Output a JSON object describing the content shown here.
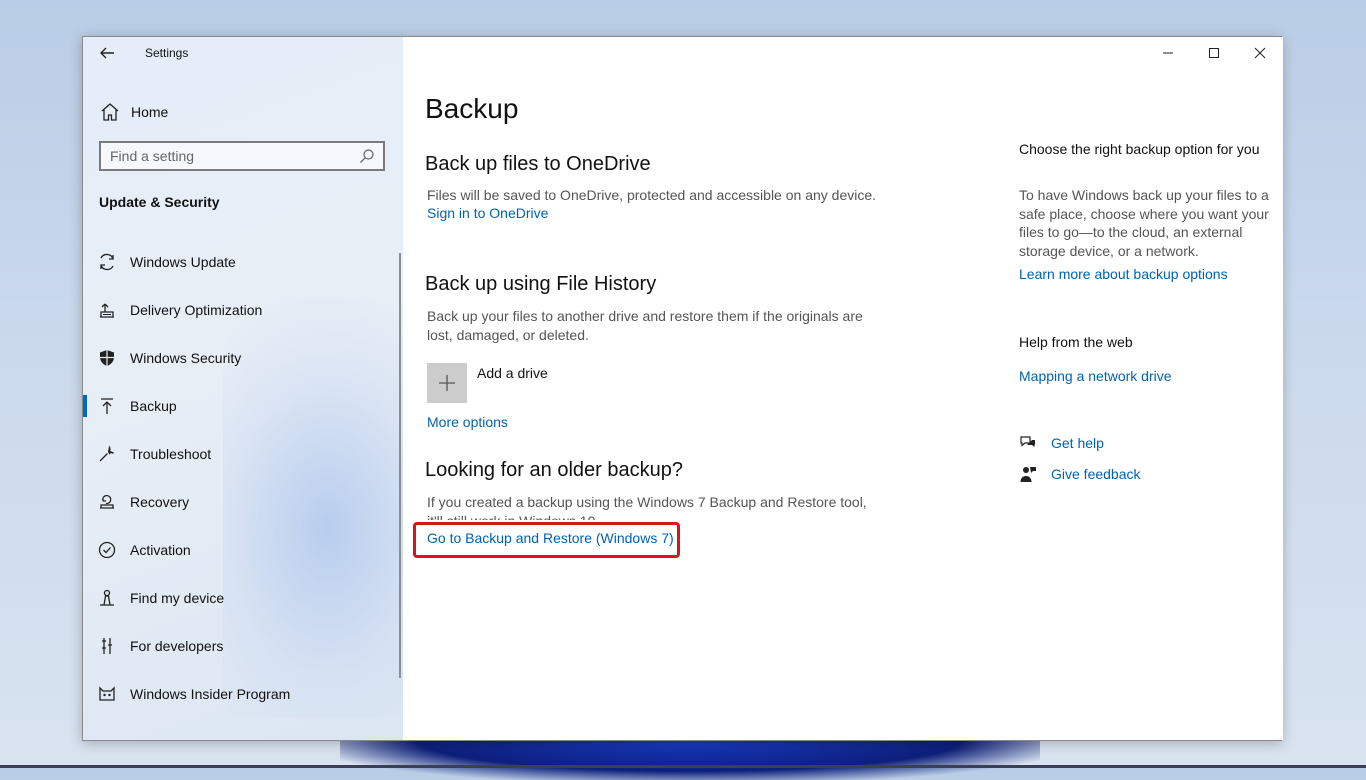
{
  "window": {
    "app_title": "Settings"
  },
  "sidebar": {
    "home_label": "Home",
    "search_placeholder": "Find a setting",
    "section_title": "Update & Security",
    "items": [
      {
        "label": "Windows Update",
        "icon": "refresh-icon"
      },
      {
        "label": "Delivery Optimization",
        "icon": "delivery-optimization-icon"
      },
      {
        "label": "Windows Security",
        "icon": "shield-icon"
      },
      {
        "label": "Backup",
        "icon": "upload-arrow-icon",
        "selected": true
      },
      {
        "label": "Troubleshoot",
        "icon": "wrench-icon"
      },
      {
        "label": "Recovery",
        "icon": "recovery-icon"
      },
      {
        "label": "Activation",
        "icon": "check-circle-icon"
      },
      {
        "label": "Find my device",
        "icon": "person-locate-icon"
      },
      {
        "label": "For developers",
        "icon": "developer-tools-icon"
      },
      {
        "label": "Windows Insider Program",
        "icon": "insider-cat-icon"
      }
    ]
  },
  "main": {
    "page_title": "Backup",
    "onedrive": {
      "heading": "Back up files to OneDrive",
      "description": "Files will be saved to OneDrive, protected and accessible on any device.",
      "link": "Sign in to OneDrive"
    },
    "file_history": {
      "heading": "Back up using File History",
      "description": "Back up your files to another drive and restore them if the originals are lost, damaged, or deleted.",
      "add_drive_label": "Add a drive",
      "more_options": "More options"
    },
    "older_backup": {
      "heading": "Looking for an older backup?",
      "description": "If you created a backup using the Windows 7 Backup and Restore tool, it'll still work in Windows 10.",
      "link": "Go to Backup and Restore (Windows 7)"
    }
  },
  "aside": {
    "choose_title": "Choose the right backup option for you",
    "choose_text": "To have Windows back up your files to a safe place, choose where you want your files to go—to the cloud, an external storage device, or a network.",
    "learn_more": "Learn more about backup options",
    "help_title": "Help from the web",
    "help_link": "Mapping a network drive",
    "get_help": "Get help",
    "give_feedback": "Give feedback"
  },
  "colors": {
    "accent": "#0067c0",
    "link": "#0063b1",
    "highlight": "#d6151d"
  }
}
